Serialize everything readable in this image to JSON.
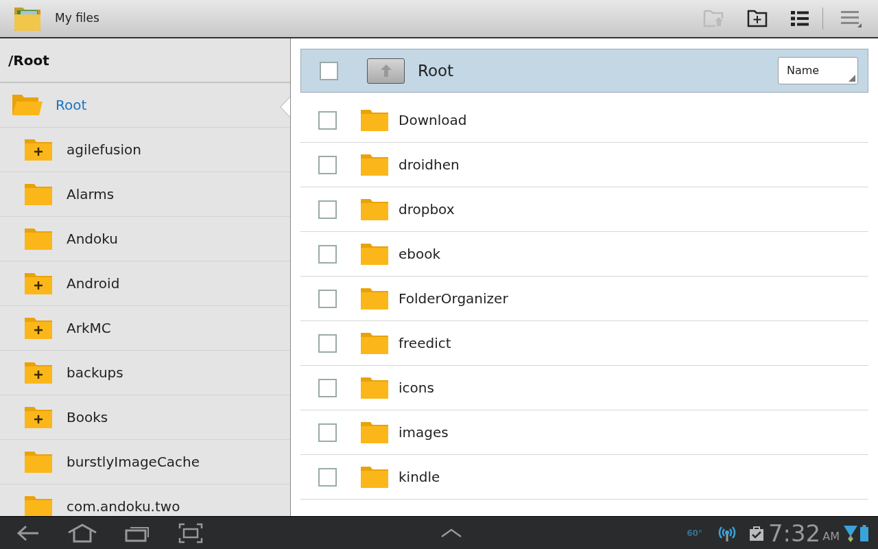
{
  "action_bar": {
    "title": "My files"
  },
  "sidebar": {
    "path": "/Root",
    "tree": [
      {
        "label": "Root",
        "selected": true,
        "expanded": true,
        "children": [
          {
            "label": "agilefusion",
            "selected": false,
            "has_children": true
          },
          {
            "label": "Alarms",
            "selected": false,
            "has_children": false
          },
          {
            "label": "Andoku",
            "selected": false,
            "has_children": false
          },
          {
            "label": "Android",
            "selected": false,
            "has_children": true
          },
          {
            "label": "ArkMC",
            "selected": false,
            "has_children": true
          },
          {
            "label": "backups",
            "selected": false,
            "has_children": true
          },
          {
            "label": "Books",
            "selected": false,
            "has_children": true
          },
          {
            "label": "burstlyImageCache",
            "selected": false,
            "has_children": false
          },
          {
            "label": "com.andoku.two",
            "selected": false,
            "has_children": false
          }
        ]
      }
    ]
  },
  "list_header": {
    "title": "Root",
    "checked": false,
    "sort": "Name"
  },
  "files": [
    {
      "name": "Download",
      "checked": false
    },
    {
      "name": "droidhen",
      "checked": false
    },
    {
      "name": "dropbox",
      "checked": false
    },
    {
      "name": "ebook",
      "checked": false
    },
    {
      "name": "FolderOrganizer",
      "checked": false
    },
    {
      "name": "freedict",
      "checked": false
    },
    {
      "name": "icons",
      "checked": false
    },
    {
      "name": "images",
      "checked": false
    },
    {
      "name": "kindle",
      "checked": false
    }
  ],
  "status_bar": {
    "temperature": "60°",
    "time": "7:32",
    "meridiem": "AM"
  }
}
